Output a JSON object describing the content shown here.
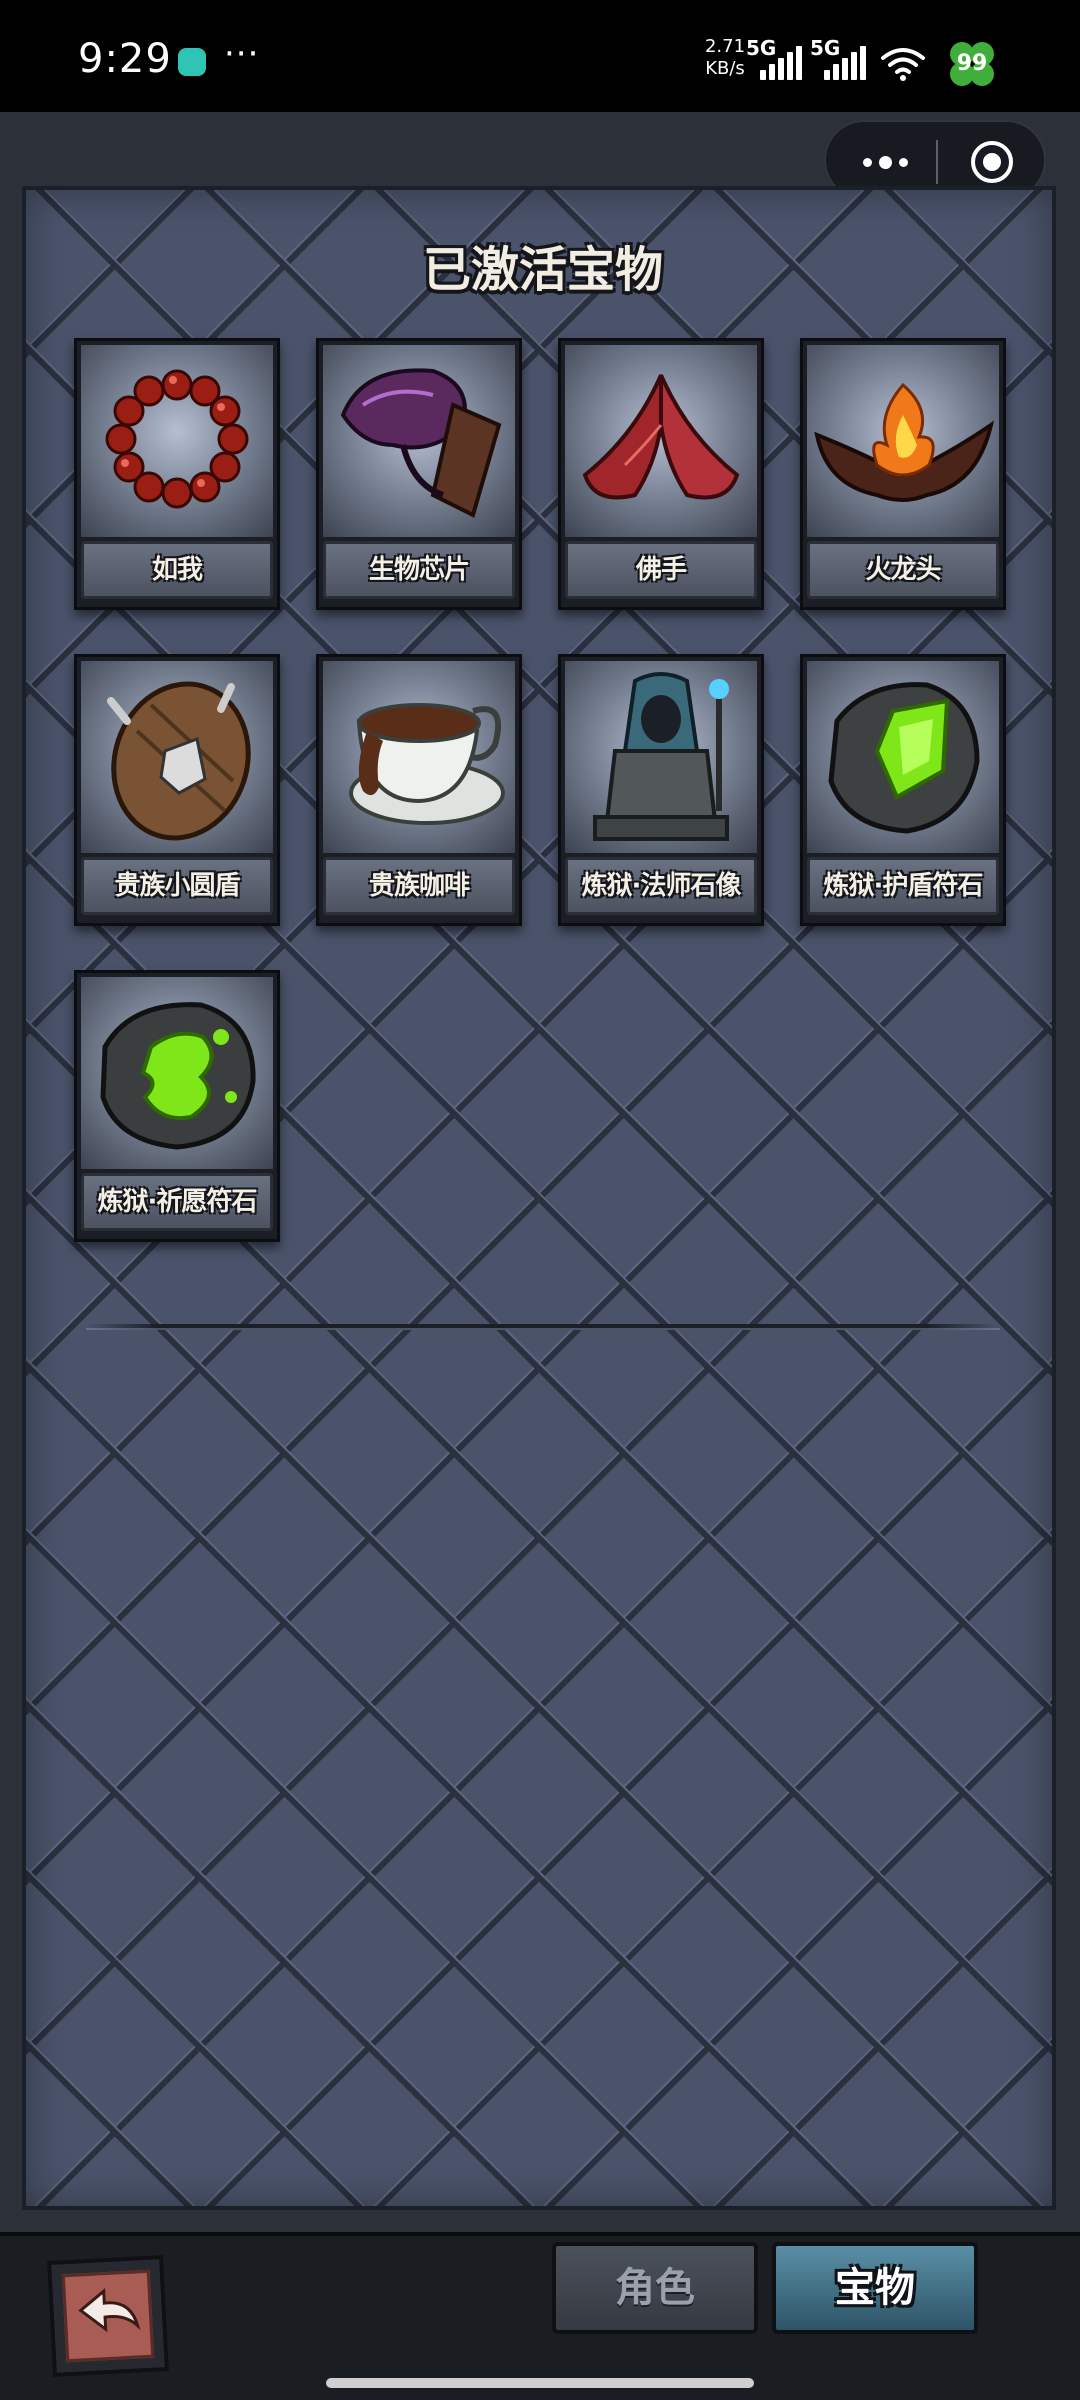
{
  "status_bar": {
    "time": "9:29",
    "more": "···",
    "net_speed_value": "2.71",
    "net_speed_unit": "KB/s",
    "sim1_label": "5G",
    "sim2_label": "5G",
    "battery": "99",
    "icons": [
      "app-notification-icon",
      "signal-icon",
      "wifi-icon",
      "battery-clover-icon"
    ]
  },
  "miniprogram_capsule": {
    "icons": [
      "more-dots-icon",
      "close-target-icon"
    ]
  },
  "panel": {
    "title": "已激活宝物"
  },
  "treasures": [
    {
      "name": "如我",
      "icon": "prayer-beads-icon"
    },
    {
      "name": "生物芯片",
      "icon": "bio-chip-icon"
    },
    {
      "name": "佛手",
      "icon": "buddha-hand-icon"
    },
    {
      "name": "火龙头",
      "icon": "fire-dragon-head-icon"
    },
    {
      "name": "贵族小圆盾",
      "icon": "round-shield-icon"
    },
    {
      "name": "贵族咖啡",
      "icon": "coffee-cup-icon"
    },
    {
      "name": "炼狱·法师石像",
      "icon": "mage-statue-icon"
    },
    {
      "name": "炼狱·护盾符石",
      "icon": "shield-rune-stone-icon"
    },
    {
      "name": "炼狱·祈愿符石",
      "icon": "wish-rune-stone-icon"
    }
  ],
  "bottom_nav": {
    "tabs": [
      {
        "label": "角色",
        "active": false
      },
      {
        "label": "宝物",
        "active": true
      }
    ],
    "back_icon": "back-arrow-icon"
  },
  "colors": {
    "panel_bg": "#4a536a",
    "active_tab": "#5a8fa6",
    "back_button": "#a85c54",
    "rune_glow": "#7ee619"
  }
}
